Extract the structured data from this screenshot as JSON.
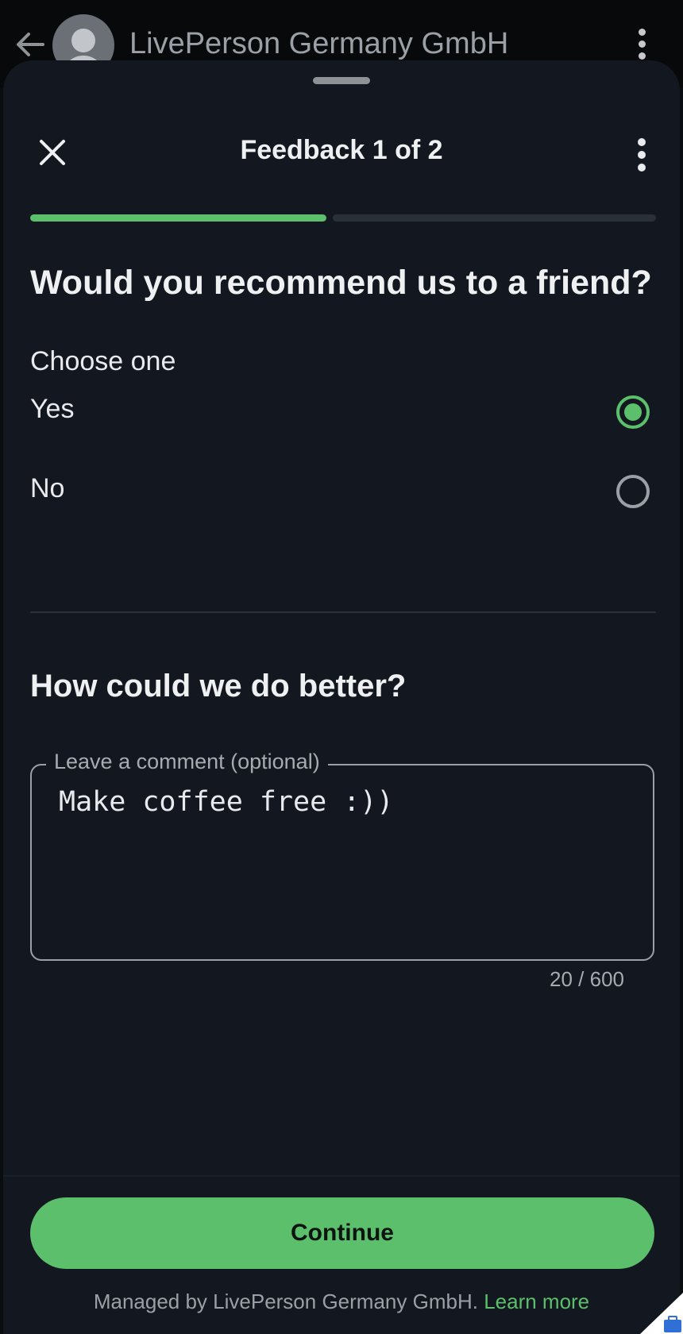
{
  "app_bar": {
    "back_icon": "arrow-left-icon",
    "avatar_icon": "person-avatar-icon",
    "title": "LivePerson Germany GmbH",
    "menu_icon": "more-vertical-icon"
  },
  "sheet": {
    "close_icon": "close-icon",
    "title": "Feedback 1 of 2",
    "menu_icon": "more-vertical-icon",
    "progress": {
      "current_step": 1,
      "total_steps": 2
    }
  },
  "question1": {
    "text": "Would you recommend us to a friend?",
    "hint": "Choose one",
    "options": [
      {
        "label": "Yes",
        "selected": true
      },
      {
        "label": "No",
        "selected": false
      }
    ]
  },
  "question2": {
    "text": "How could we do better?",
    "field_label": "Leave a comment (optional)",
    "value": "Make coffee free :))",
    "counter": "20 / 600"
  },
  "footer": {
    "continue_label": "Continue",
    "managed_text": "Managed by LivePerson Germany GmbH.",
    "learn_more": "Learn more"
  },
  "colors": {
    "accent": "#5cbf6b",
    "sheet_background": "#131820",
    "app_bar_background": "#07090b"
  }
}
